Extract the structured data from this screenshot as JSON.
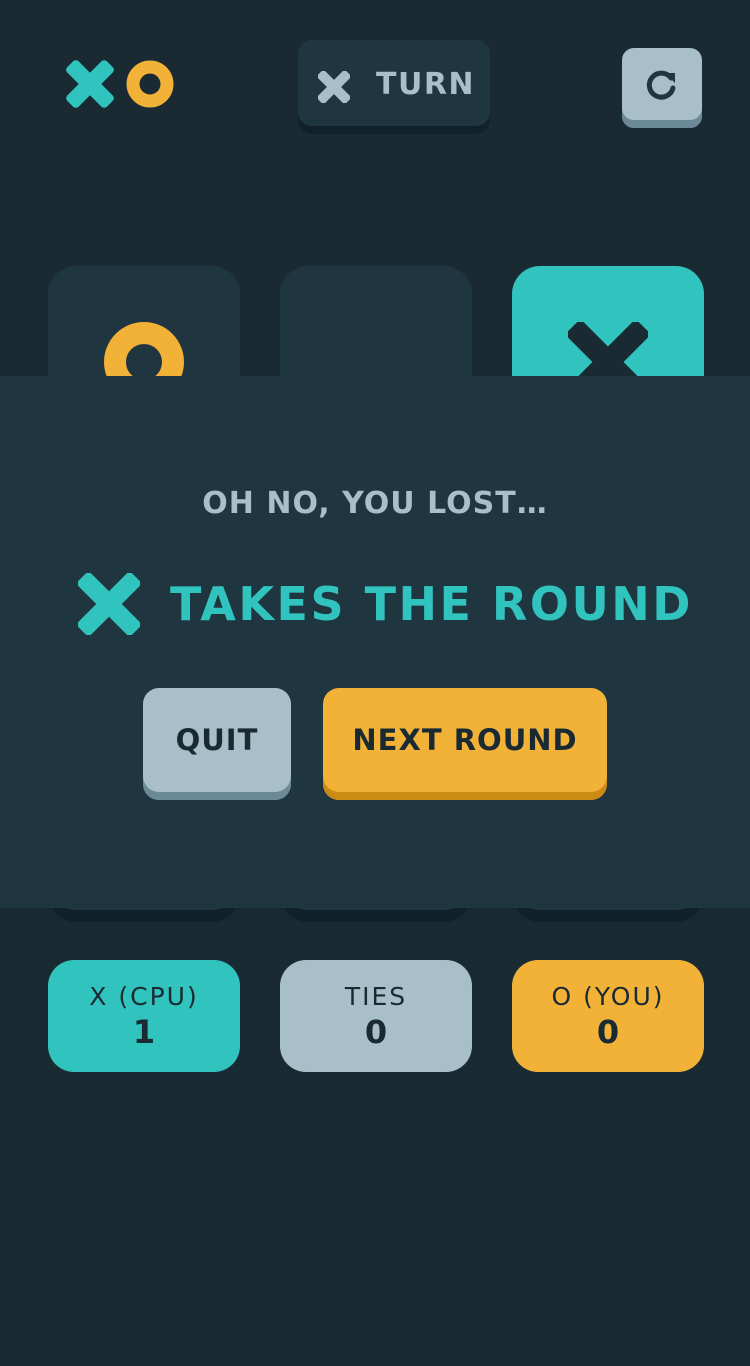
{
  "header": {
    "turn_label": "TURN",
    "turn_mark": "x-icon"
  },
  "board": {
    "cells": [
      "o",
      "",
      "x",
      "",
      "",
      "",
      "",
      "",
      ""
    ],
    "highlight_cell": 2
  },
  "scores": [
    {
      "label": "X (CPU)",
      "value": "1"
    },
    {
      "label": "TIES",
      "value": "0"
    },
    {
      "label": "O (YOU)",
      "value": "0"
    }
  ],
  "modal": {
    "subtitle": "OH NO, YOU LOST…",
    "title": "TAKES THE ROUND",
    "winner_mark": "x-icon",
    "quit_label": "QUIT",
    "next_label": "NEXT ROUND"
  },
  "colors": {
    "background": "#1A2A33",
    "tile": "#1F3641",
    "x": "#31C3BD",
    "o": "#F2B137",
    "silver": "#A8BFC9"
  }
}
